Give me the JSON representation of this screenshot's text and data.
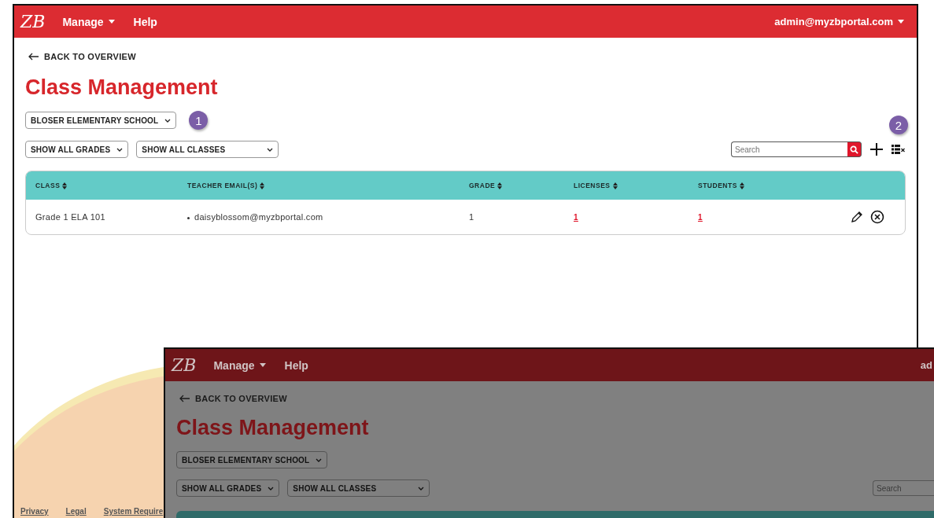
{
  "header": {
    "logo": "ZB",
    "menu": [
      {
        "label": "Manage",
        "dropdown": true
      },
      {
        "label": "Help",
        "dropdown": false
      }
    ],
    "user": "admin@myzbportal.com"
  },
  "back_link": "BACK TO OVERVIEW",
  "title": "Class Management",
  "school_select": "BLOSER ELEMENTARY SCHOOL",
  "callouts": [
    "1",
    "2"
  ],
  "filters": [
    "SHOW ALL GRADES",
    "SHOW ALL CLASSES"
  ],
  "search": {
    "placeholder": "Search"
  },
  "table": {
    "columns": [
      "CLASS",
      "TEACHER EMAIL(S)",
      "GRADE",
      "LICENSES",
      "STUDENTS"
    ],
    "rows": [
      {
        "class": "Grade 1 ELA 101",
        "teachers": [
          "daisyblossom@myzbportal.com"
        ],
        "grade": "1",
        "licenses": "1",
        "students": "1"
      }
    ]
  },
  "footer_links": [
    "Privacy",
    "Legal",
    "System Require"
  ],
  "inset": {
    "header": {
      "logo": "ZB",
      "menu": [
        {
          "label": "Manage",
          "dropdown": true
        },
        {
          "label": "Help",
          "dropdown": false
        }
      ],
      "user": "ad"
    },
    "back_link": "BACK TO OVERVIEW",
    "title": "Class Management",
    "school_select": "BLOSER ELEMENTARY SCHOOL",
    "filters": [
      "SHOW ALL GRADES",
      "SHOW ALL CLASSES"
    ],
    "search": {
      "placeholder": "Search"
    }
  }
}
